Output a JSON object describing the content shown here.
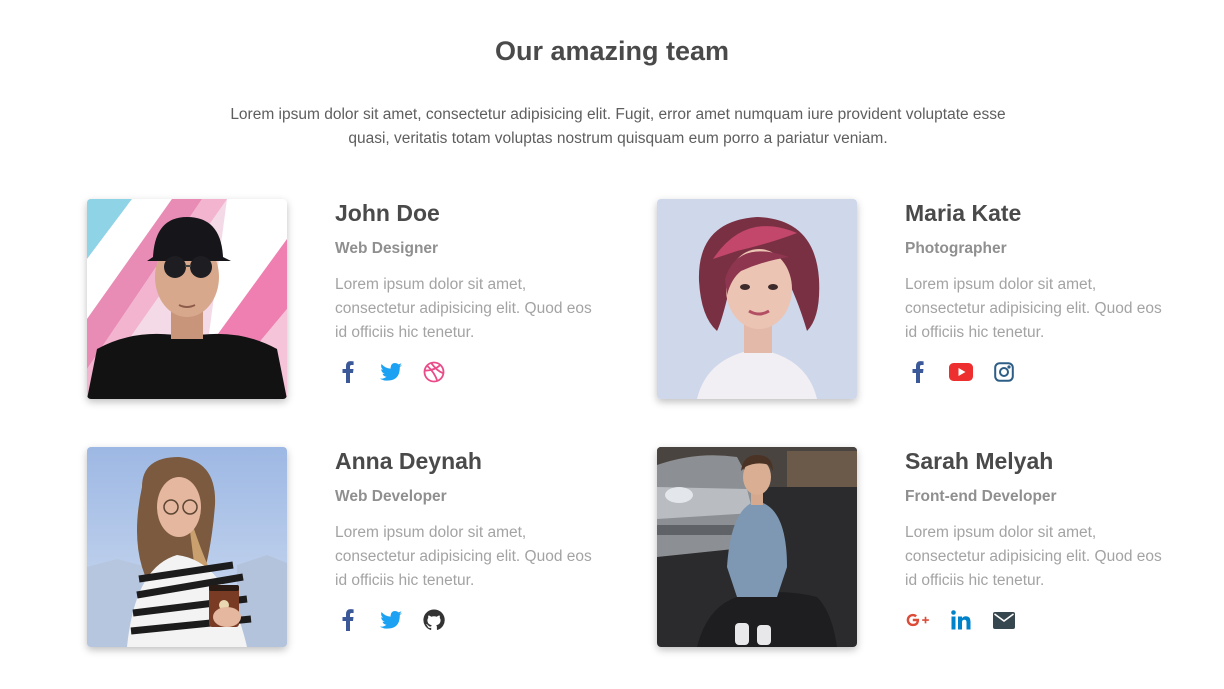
{
  "header": {
    "title": "Our amazing team",
    "intro": "Lorem ipsum dolor sit amet, consectetur adipisicing elit. Fugit, error amet numquam iure provident voluptate esse quasi, veritatis totam voluptas nostrum quisquam eum porro a pariatur veniam."
  },
  "members": [
    {
      "name": "John Doe",
      "role": "Web Designer",
      "bio": "Lorem ipsum dolor sit amet, consectetur adipisicing elit. Quod eos id officiis hic tenetur.",
      "socials": [
        {
          "icon": "facebook-icon",
          "color": "#3b5998"
        },
        {
          "icon": "twitter-icon",
          "color": "#1da1f2"
        },
        {
          "icon": "dribbble-icon",
          "color": "#ea4c89"
        }
      ]
    },
    {
      "name": "Maria Kate",
      "role": "Photographer",
      "bio": "Lorem ipsum dolor sit amet, consectetur adipisicing elit. Quod eos id officiis hic tenetur.",
      "socials": [
        {
          "icon": "facebook-icon",
          "color": "#3b5998"
        },
        {
          "icon": "youtube-icon",
          "color": "#ed302f"
        },
        {
          "icon": "instagram-icon",
          "color": "#2e5e86"
        }
      ]
    },
    {
      "name": "Anna Deynah",
      "role": "Web Developer",
      "bio": "Lorem ipsum dolor sit amet, consectetur adipisicing elit. Quod eos id officiis hic tenetur.",
      "socials": [
        {
          "icon": "facebook-icon",
          "color": "#3b5998"
        },
        {
          "icon": "twitter-icon",
          "color": "#1da1f2"
        },
        {
          "icon": "github-icon",
          "color": "#333333"
        }
      ]
    },
    {
      "name": "Sarah Melyah",
      "role": "Front-end Developer",
      "bio": "Lorem ipsum dolor sit amet, consectetur adipisicing elit. Quod eos id officiis hic tenetur.",
      "socials": [
        {
          "icon": "google-plus-icon",
          "color": "#dd4b39"
        },
        {
          "icon": "linkedin-icon",
          "color": "#0082ca"
        },
        {
          "icon": "email-icon",
          "color": "#37474f"
        }
      ]
    }
  ]
}
